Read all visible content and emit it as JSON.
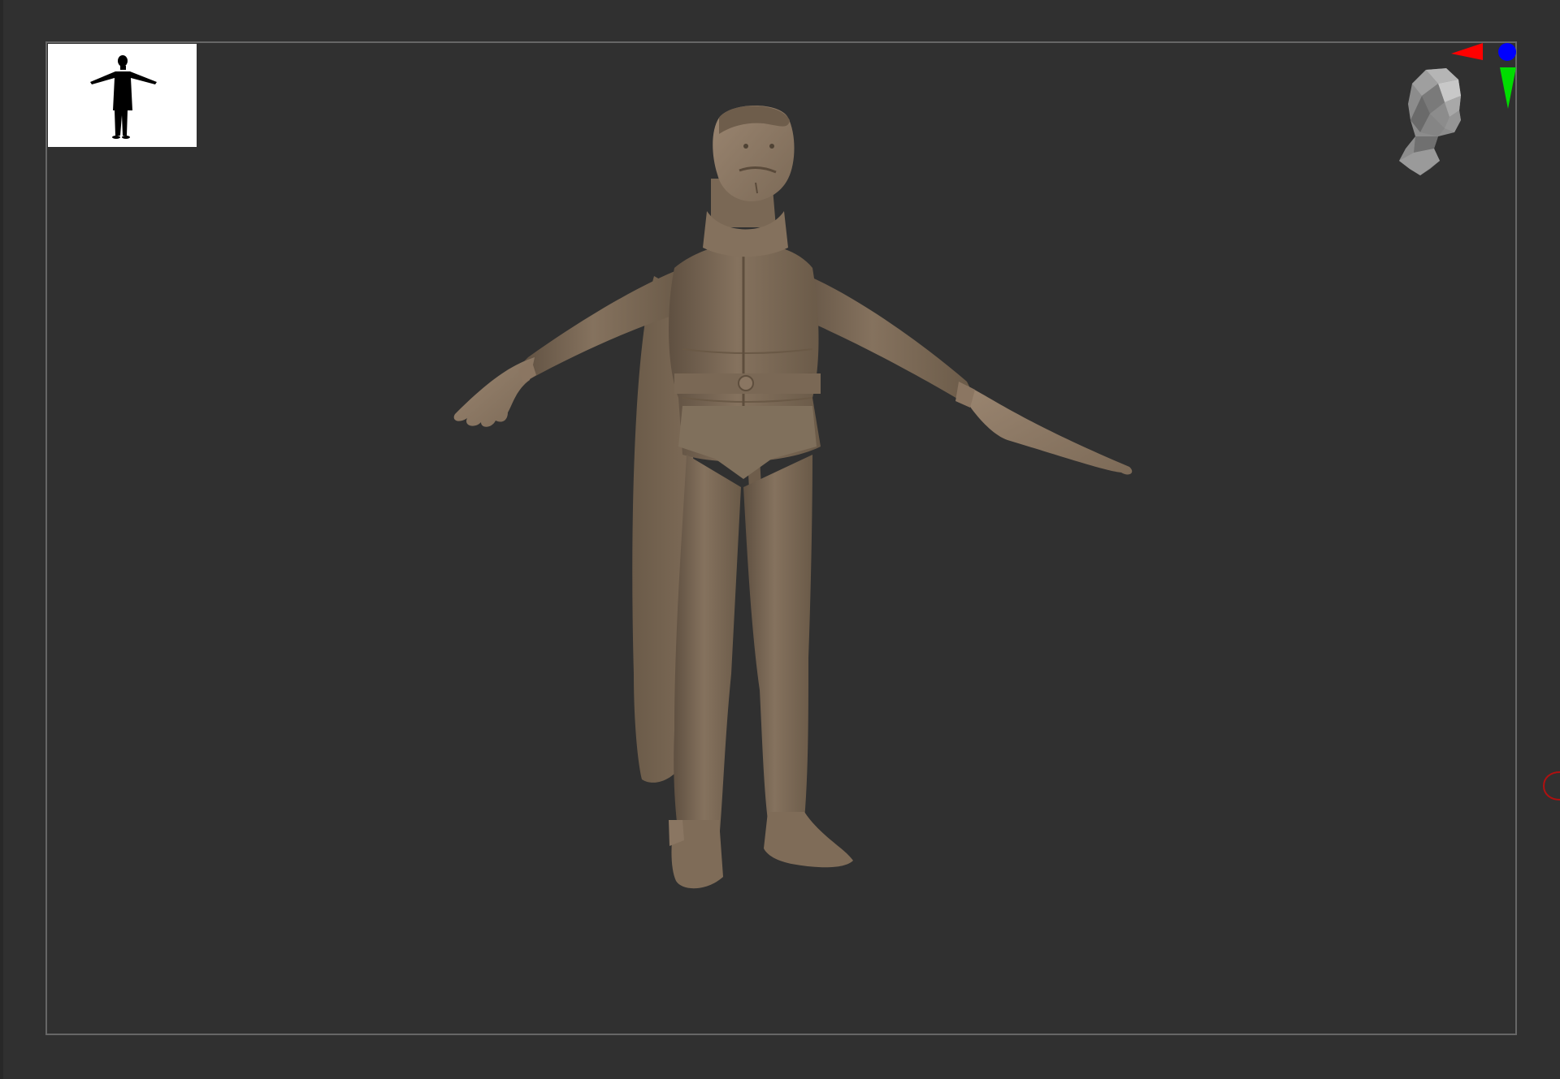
{
  "viewport": {
    "background_color": "#303030",
    "frame_color": "#666666",
    "thumbnail_background": "#ffffff",
    "model_color": "#7c6a57"
  },
  "icons": {
    "silhouette": "t-pose-silhouette-icon",
    "navigation_head": "navigation-head-icon",
    "axis_x": "x-axis-arrow-icon",
    "axis_y": "y-axis-arrow-icon",
    "axis_z": "z-axis-dot-icon",
    "edge_marker": "edge-marker-icon"
  },
  "axis_colors": {
    "x": "#ff0000",
    "y": "#00e000",
    "z": "#0000ff"
  }
}
